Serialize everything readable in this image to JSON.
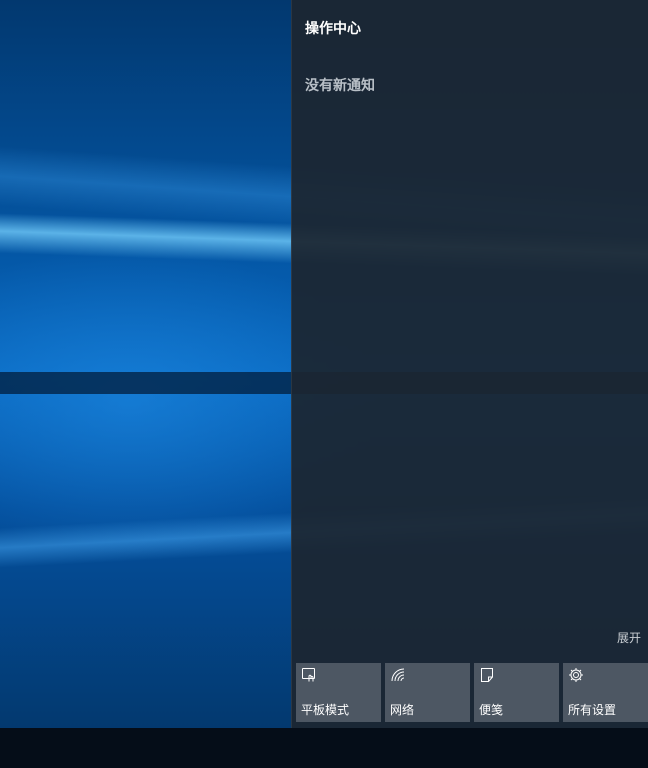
{
  "action_center": {
    "title": "操作中心",
    "empty_message": "没有新通知",
    "expand_label": "展开",
    "quick_actions": [
      {
        "label": "平板模式",
        "icon": "tablet-mode-icon"
      },
      {
        "label": "网络",
        "icon": "network-icon"
      },
      {
        "label": "便笺",
        "icon": "note-icon"
      },
      {
        "label": "所有设置",
        "icon": "settings-gear-icon"
      }
    ]
  },
  "colors": {
    "panel_bg": "#1c2630",
    "tile_bg": "#787f88",
    "text_primary": "#ffffff",
    "text_secondary": "#b9c0c7",
    "taskbar_bg": "#050d18"
  }
}
